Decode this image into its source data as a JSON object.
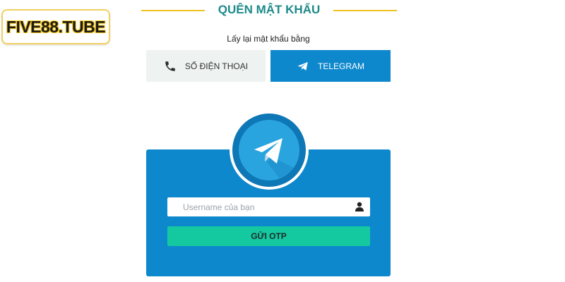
{
  "logo": {
    "text": "FIVE88.TUBE"
  },
  "header": {
    "title": "QUÊN MẬT KHẨU"
  },
  "subtitle": "Lấy lại mật khẩu bằng",
  "tabs": [
    {
      "label": "SỐ ĐIỆN THOẠI",
      "icon": "phone-icon",
      "active": false
    },
    {
      "label": "TELEGRAM",
      "icon": "telegram-icon",
      "active": true
    }
  ],
  "form": {
    "username_placeholder": "Username của bạn",
    "username_value": "",
    "submit_label": "GỬI OTP"
  },
  "colors": {
    "accent_blue": "#0e88cc",
    "title_teal": "#1d8a8a",
    "title_line_gold": "#f0c020",
    "button_green": "#14c9a0",
    "inactive_tab": "#eef2f1"
  }
}
